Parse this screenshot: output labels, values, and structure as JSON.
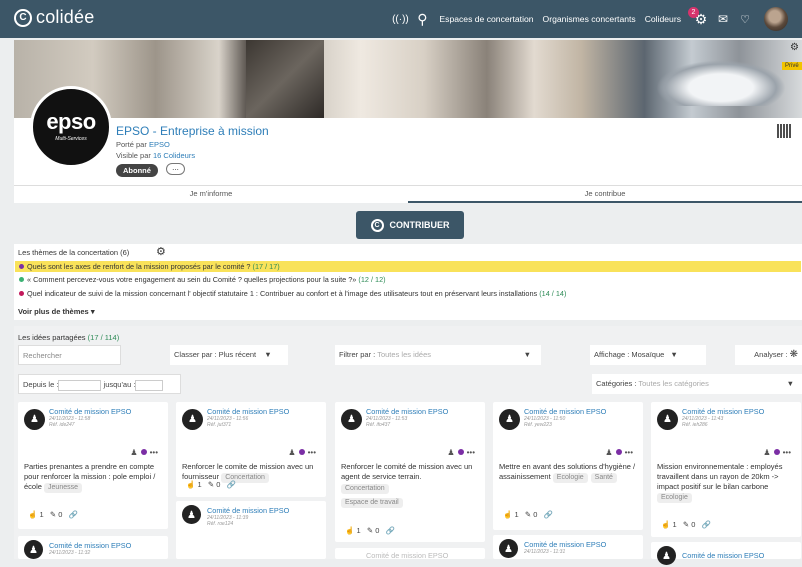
{
  "topbar": {
    "logo_icon": "C",
    "logo_text": "colidée",
    "links": [
      "Espaces de concertation",
      "Organismes concertants",
      "Colideurs"
    ],
    "notification_badge": "2"
  },
  "banner": {
    "badge": "Privé"
  },
  "org": {
    "logo_main": "epso",
    "logo_sub": "Multi-Services",
    "name": "EPSO - Entreprise à mission",
    "porte_label": "Porté par",
    "porte_value": "EPSO",
    "visible_label": "Visible par",
    "visible_value": "16 Colideurs",
    "abonne": "Abonné",
    "more": "..."
  },
  "tabs": [
    "Je m'informe",
    "Je contribue"
  ],
  "contribuer": {
    "icon": "C",
    "label": "CONTRIBUER"
  },
  "themes": {
    "title": "Les thèmes de la concertation (6)",
    "items": [
      {
        "text": "Quels sont les axes de renfort de la mission proposés par le comité ?",
        "count": "(17 / 17)",
        "color": "#7b2ea5"
      },
      {
        "text": "« Comment percevez-vous votre engagement au sein du Comité ? quelles projections pour la suite ?»",
        "count": "(12 / 12)",
        "color": "#3bb273"
      },
      {
        "text": "Quel indicateur de suivi de la mission concernant l' objectif statutaire 1 : Contribuer au confort et à l'image des utilisateurs tout en préservant leurs installations",
        "count": "(14 / 14)",
        "color": "#c2185b"
      }
    ],
    "voir_plus": "Voir plus de thèmes"
  },
  "ideas": {
    "title": "Les idées partagées",
    "count": "(17 / 114)",
    "search_placeholder": "Rechercher",
    "sort": "Classer par : Plus récent",
    "filter_label": "Filtrer par :",
    "filter_value": "Toutes les idées",
    "affichage": "Affichage : Mosaïque",
    "analyser": "Analyser :",
    "depuis": "Depuis le :",
    "jusquau": "jusqu'au :",
    "categories_label": "Catégories :",
    "categories_value": "Toutes les catégories"
  },
  "cards": [
    {
      "author": "Comité de mission EPSO",
      "date": "24/11/2023 - 11:58",
      "ref": "Réf. ide247",
      "text": "Parties prenantes a prendre en compte pour renforcer la mission : pole emploi / école",
      "tags": [
        "Jeunesse"
      ],
      "likes": "1",
      "edits": "0"
    },
    {
      "author": "Comité de mission EPSO",
      "date": "24/11/2023 - 11:56",
      "ref": "Réf. jut371",
      "text": "Renforcer le comite de mission avec un fournisseur",
      "tags": [
        "Concertation"
      ],
      "likes": "1",
      "edits": "0"
    },
    {
      "author": "Comité de mission EPSO",
      "date": "24/11/2023 - 11:53",
      "ref": "Réf. ifo437",
      "text": "Renforcer le comité de mission avec un agent de service terrain.",
      "tags": [
        "Concertation",
        "Espace de travail"
      ],
      "likes": "1",
      "edits": "0"
    },
    {
      "author": "Comité de mission EPSO",
      "date": "24/11/2023 - 11:50",
      "ref": "Réf. yew223",
      "text": "Mettre en avant des solutions d'hygiène / assainissement",
      "tags": [
        "Ecologie",
        "Santé"
      ],
      "likes": "1",
      "edits": "0"
    },
    {
      "author": "Comité de mission EPSO",
      "date": "24/11/2023 - 11:43",
      "ref": "Réf. ieh286",
      "text": "Mission environnementale : employés travaillent dans un rayon de 20km -> impact positif sur le bilan carbone",
      "tags": [
        "Ecologie"
      ],
      "likes": "1",
      "edits": "0"
    }
  ],
  "cards_row2": [
    {
      "author": "Comité de mission EPSO",
      "date": "24/11/2023 - 11:32"
    },
    {
      "author": "Comité de mission EPSO",
      "date": "24/11/2023 - 11:39",
      "ref": "Réf. roe124"
    },
    {
      "author": "Comité de mission EPSO",
      "date": ""
    },
    {
      "author": "Comité de mission EPSO",
      "date": "24/11/2023 - 11:31"
    },
    {
      "author": "Comité de mission EPSO",
      "date": ""
    }
  ]
}
